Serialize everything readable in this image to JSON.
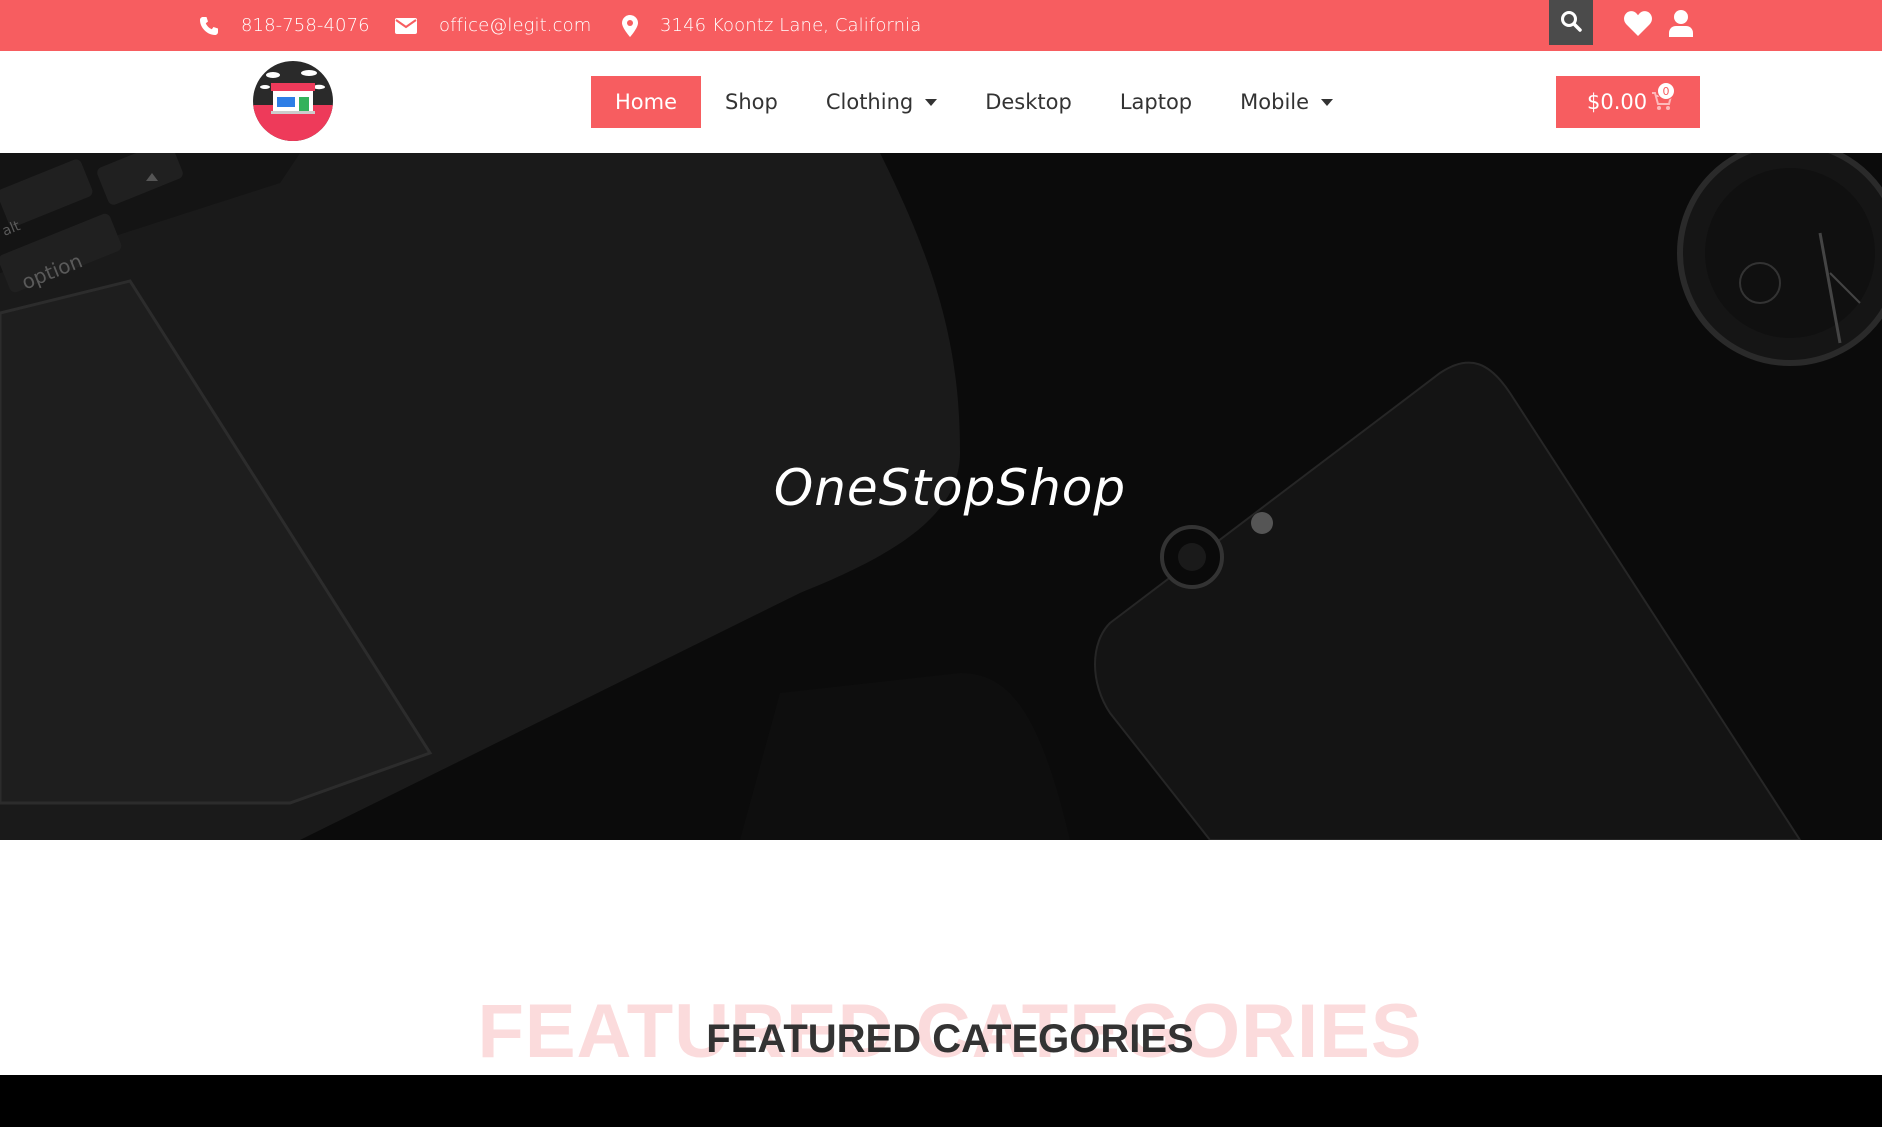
{
  "topbar": {
    "phone": "818-758-4076",
    "email": "office@legit.com",
    "address": "3146 Koontz Lane, California",
    "icons": [
      "phone-icon",
      "envelope-icon",
      "map-pin-icon",
      "search-icon",
      "heart-icon",
      "user-icon"
    ]
  },
  "nav": {
    "items": [
      {
        "label": "Home",
        "active": true
      },
      {
        "label": "Shop"
      },
      {
        "label": "Clothing",
        "dropdown": true
      },
      {
        "label": "Desktop"
      },
      {
        "label": "Laptop"
      },
      {
        "label": "Mobile",
        "dropdown": true
      }
    ]
  },
  "cart": {
    "total": "$0.00",
    "count": "0"
  },
  "hero": {
    "title": "OneStopShop"
  },
  "featured": {
    "ghost_title": "FEATURED CATEGORIES",
    "title": "FEATURED CATEGORIES"
  },
  "colors": {
    "accent": "#f75d60",
    "dark": "#4b4b4b"
  }
}
